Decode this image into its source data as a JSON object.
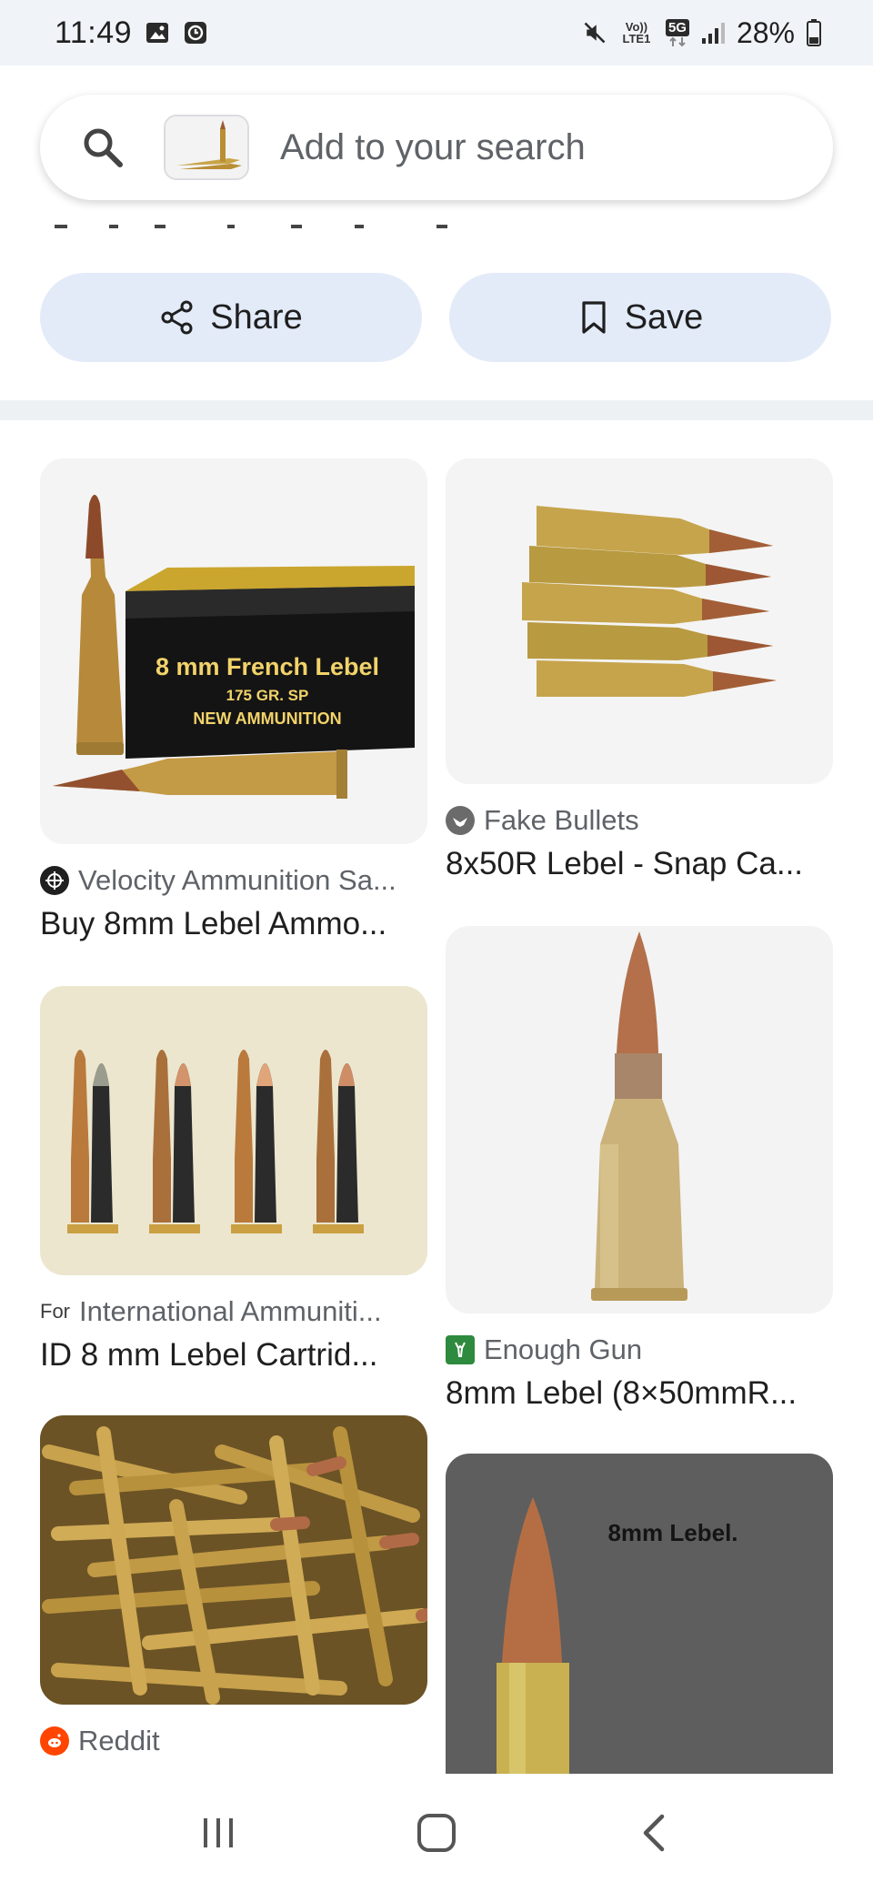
{
  "status_bar": {
    "time": "11:49",
    "battery": "28%",
    "network_volte": "Vo)) LTE1",
    "network_gen": "5G",
    "icons": [
      "image-icon",
      "clock-icon",
      "mute-icon",
      "signal-icon",
      "battery-icon"
    ]
  },
  "search": {
    "placeholder": "Add to your search",
    "icon": "search-icon"
  },
  "actions": {
    "share_label": "Share",
    "save_label": "Save"
  },
  "results": [
    {
      "source": "Velocity Ammunition Sa...",
      "title": "Buy 8mm Lebel Ammo...",
      "box_text_1": "8 mm French Lebel",
      "box_text_2": "175 GR. SP",
      "box_text_3": "NEW AMMUNITION"
    },
    {
      "source": "Fake Bullets",
      "title": "8x50R Lebel - Snap Ca..."
    },
    {
      "source": "International Ammuniti...",
      "source_prefix": "For",
      "title": "ID 8 mm Lebel Cartrid..."
    },
    {
      "source": "Enough Gun",
      "title": "8mm Lebel (8×50mmR..."
    },
    {
      "source": "Reddit",
      "title": ""
    },
    {
      "image_caption": "8mm Lebel."
    }
  ],
  "colors": {
    "status_bg": "#f0f4f9",
    "button_bg": "#e3ebf9",
    "text_primary": "#1f1f1f",
    "text_secondary": "#5f6368",
    "brass": "#b8963a",
    "copper": "#a0603a"
  },
  "nav": {
    "icons": [
      "recents-icon",
      "home-icon",
      "back-icon"
    ]
  }
}
